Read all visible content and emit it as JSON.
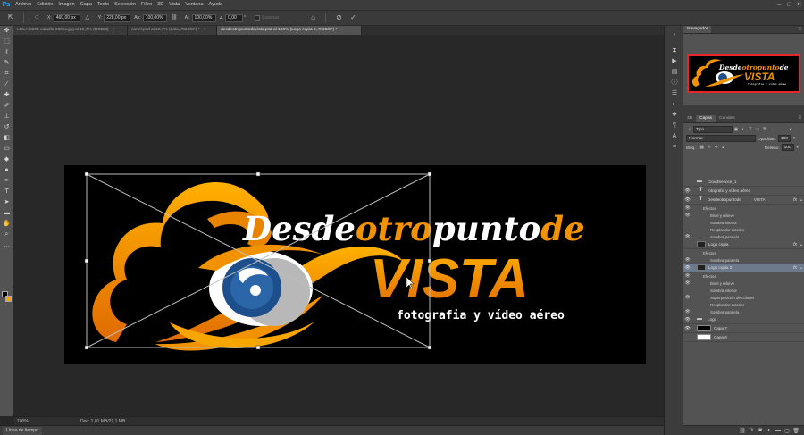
{
  "app": {
    "logo": "Ps"
  },
  "menu": [
    "Archivo",
    "Edición",
    "Imagen",
    "Capa",
    "Texto",
    "Selección",
    "Filtro",
    "3D",
    "Vista",
    "Ventana",
    "Ayuda"
  ],
  "window_controls": [
    "–",
    "□",
    "✕"
  ],
  "options": {
    "x_label": "X:",
    "x_value": "460,00 px",
    "y_label": "Y:",
    "y_value": "228,00 px",
    "w_label": "An:",
    "w_value": "100,00%",
    "h_label": "Al:",
    "h_value": "100,00%",
    "angle_label": "∠",
    "angle_value": "0,00",
    "angle_unit": "°",
    "smooth_label": "Suavizar",
    "cancel_icon": "⊘",
    "commit_icon": "✓"
  },
  "tabs": [
    {
      "label": "LOLA-6930-caballo-600px.jpg al 16,7% (RGB/8)",
      "active": false
    },
    {
      "label": "cartel.psd al 16,7% (Lola, RGB/8*) *",
      "active": false
    },
    {
      "label": "desdeotropuntodevista.psd al 100% (Logo copia 2, RGB/8*) *",
      "active": true
    }
  ],
  "logo": {
    "line1_white": "Desde",
    "line1_orange": "otro",
    "line1_white2": "punto",
    "line1_orange2": "de",
    "big": "VISTA",
    "tagline": "fotografia y vídeo aéreo"
  },
  "navigator_thumb": {
    "line1_white": "Desde",
    "line1_orange": "otropunto",
    "line1_white2": "de",
    "big": "VISTA",
    "tagline": "fotografia y vídeo aéreo"
  },
  "colors": {
    "orange": "#f39200",
    "accent_blue": "#1c4f8c",
    "nav_frame": "#e8262a"
  },
  "status": {
    "zoom": "100%",
    "doc": "Doc: 1,01 MB/29,1 MB"
  },
  "timeline_tab": "Línea de tiempo",
  "navigator": {
    "tab": "Navegador"
  },
  "layers_panel": {
    "tabs": [
      "3D",
      "Capas",
      "Canales"
    ],
    "filter_label": "Tipo",
    "blend_mode": "Normal",
    "opacity_label": "Opacidad:",
    "opacity_value": "100%",
    "lock_label": "Bloq.:",
    "fill_label": "Relleno:",
    "fill_value": "100%"
  },
  "layers": [
    {
      "kind": "layer",
      "name": "CloudService_1",
      "thumb": "folder",
      "eye": false,
      "fx": false,
      "selected": false
    },
    {
      "kind": "layer",
      "name": "fotografia y vídeo aéreo",
      "thumb": "t",
      "eye": true,
      "fx": false,
      "selected": false
    },
    {
      "kind": "layer",
      "name": "Desdeotropuntode",
      "name2": "VISTA",
      "thumb": "t",
      "eye": true,
      "fx": true,
      "selected": false
    },
    {
      "kind": "effect",
      "level": 1,
      "name": "Efectos",
      "eye": true
    },
    {
      "kind": "effect",
      "level": 2,
      "name": "Bisel y relieve",
      "eye": true
    },
    {
      "kind": "effect",
      "level": 2,
      "name": "Sombra interior",
      "eye": false
    },
    {
      "kind": "effect",
      "level": 2,
      "name": "Resplandor exterior",
      "eye": false
    },
    {
      "kind": "effect",
      "level": 2,
      "name": "Sombra paralela",
      "eye": true
    },
    {
      "kind": "layer",
      "name": "Logo copia",
      "thumb": "smart",
      "eye": false,
      "fx": true,
      "selected": false
    },
    {
      "kind": "effect",
      "level": 1,
      "name": "Efectos",
      "eye": false
    },
    {
      "kind": "effect",
      "level": 2,
      "name": "Sombra paralela",
      "eye": true
    },
    {
      "kind": "layer",
      "name": "Logo copia 2",
      "thumb": "smart",
      "eye": true,
      "fx": true,
      "selected": true
    },
    {
      "kind": "effect",
      "level": 1,
      "name": "Efectos",
      "eye": true
    },
    {
      "kind": "effect",
      "level": 2,
      "name": "Bisel y relieve",
      "eye": true
    },
    {
      "kind": "effect",
      "level": 2,
      "name": "Sombra interior",
      "eye": false
    },
    {
      "kind": "effect",
      "level": 2,
      "name": "Superposición de colores",
      "eye": true
    },
    {
      "kind": "effect",
      "level": 2,
      "name": "Resplandor exterior",
      "eye": false
    },
    {
      "kind": "effect",
      "level": 2,
      "name": "Sombra paralela",
      "eye": true
    },
    {
      "kind": "layer",
      "name": "Logo",
      "thumb": "folder",
      "eye": true,
      "fx": false,
      "selected": false
    },
    {
      "kind": "layer",
      "name": "Capa 7",
      "thumb": "black",
      "eye": true,
      "fx": false,
      "selected": false
    },
    {
      "kind": "layer",
      "name": "Capa 6",
      "thumb": "white",
      "eye": false,
      "fx": false,
      "selected": false
    }
  ]
}
